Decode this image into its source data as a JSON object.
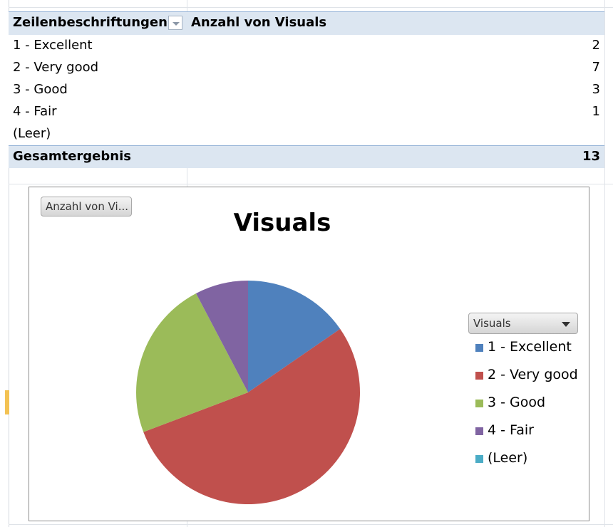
{
  "pivot": {
    "row_header": "Zeilenbeschriftungen",
    "value_header": "Anzahl von Visuals",
    "rows": [
      {
        "label": "1 - Excellent",
        "value": "2"
      },
      {
        "label": "2 - Very good",
        "value": "7"
      },
      {
        "label": "3 - Good",
        "value": "3"
      },
      {
        "label": "4 - Fair",
        "value": "1"
      },
      {
        "label": "(Leer)",
        "value": ""
      }
    ],
    "total_label": "Gesamtergebnis",
    "total_value": "13"
  },
  "chart": {
    "field_button_label": "Anzahl von Vi...",
    "legend_button_label": "Visuals"
  },
  "chart_data": {
    "type": "pie",
    "title": "Visuals",
    "categories": [
      "1 - Excellent",
      "2 - Very good",
      "3 - Good",
      "4 - Fair",
      "(Leer)"
    ],
    "values": [
      2,
      7,
      3,
      1,
      0
    ],
    "colors": [
      "#4f81bd",
      "#c0504d",
      "#9bbb59",
      "#8064a2",
      "#4bacc6"
    ],
    "legend": "right"
  }
}
